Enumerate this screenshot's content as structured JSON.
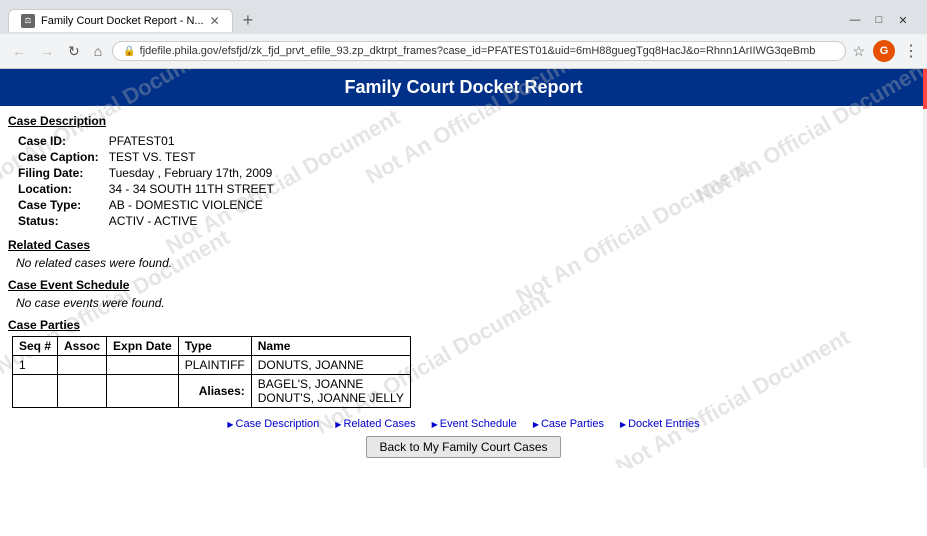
{
  "browser": {
    "tab_title": "Family Court Docket Report - N...",
    "url": "fjdefile.phila.gov/efsfjd/zk_fjd_prvt_efile_93.zp_dktrpt_frames?case_id=PFATEST01&uid=6mH88guegTgq8HacJ&o=Rhnn1ArIIWG3qeBmb",
    "new_tab_symbol": "+",
    "minimize": "—",
    "maximize": "□",
    "close": "✕",
    "profile_initials": "G"
  },
  "page": {
    "header_title": "Family Court Docket Report",
    "watermarks": [
      "Not An Official Document",
      "Not An Official Document",
      "Not An Official Document",
      "Not An Official Document",
      "Not An Official Document",
      "Not An Official Document"
    ]
  },
  "case_description": {
    "section_label": "Case Description",
    "fields": [
      {
        "label": "Case ID:",
        "value": "PFATEST01"
      },
      {
        "label": "Case Caption:",
        "value": "TEST VS. TEST"
      },
      {
        "label": "Filing Date:",
        "value": "Tuesday , February 17th, 2009"
      },
      {
        "label": "Location:",
        "value": "34 - 34 SOUTH 11TH STREET"
      },
      {
        "label": "Case Type:",
        "value": "AB - DOMESTIC VIOLENCE"
      },
      {
        "label": "Status:",
        "value": "ACTIV - ACTIVE"
      }
    ]
  },
  "related_cases": {
    "section_label": "Related Cases",
    "no_results_text": "No related cases were found."
  },
  "case_event_schedule": {
    "section_label": "Case Event Schedule",
    "no_results_text": "No case events were found."
  },
  "case_parties": {
    "section_label": "Case Parties",
    "table_headers": [
      "Seq #",
      "Assoc",
      "Expn Date",
      "Type",
      "Name"
    ],
    "rows": [
      {
        "seq": "1",
        "assoc": "",
        "expn_date": "",
        "type": "PLAINTIFF",
        "name": "DONUTS, JOANNE"
      }
    ],
    "aliases": [
      "BAGEL'S, JOANNE",
      "DONUT'S, JOANNE JELLY"
    ],
    "alias_label": "Aliases:"
  },
  "nav_links": [
    {
      "label": "Case Description",
      "href": "#"
    },
    {
      "label": "Related Cases",
      "href": "#"
    },
    {
      "label": "Event Schedule",
      "href": "#"
    },
    {
      "label": "Case Parties",
      "href": "#"
    },
    {
      "label": "Docket Entries",
      "href": "#"
    }
  ],
  "back_button_label": "Back to My Family Court Cases"
}
